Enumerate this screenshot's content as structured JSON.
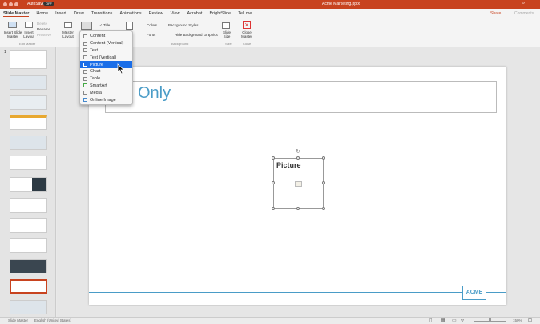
{
  "titlebar": {
    "autosave": "AutoSave",
    "autosave_state": "OFF",
    "filename": "Acme Marketing.pptx"
  },
  "tabs": [
    {
      "label": "Slide Master",
      "active": true
    },
    {
      "label": "Home"
    },
    {
      "label": "Insert"
    },
    {
      "label": "Draw"
    },
    {
      "label": "Transitions"
    },
    {
      "label": "Animations"
    },
    {
      "label": "Review"
    },
    {
      "label": "View"
    },
    {
      "label": "Acrobat"
    },
    {
      "label": "BrightSlide"
    },
    {
      "label": "Tell me"
    }
  ],
  "share": {
    "share": "Share",
    "comments": "Comments"
  },
  "ribbon": {
    "insert_slide_master": "Insert Slide Master",
    "insert_layout": "Insert Layout",
    "delete": "Delete",
    "rename": "Rename",
    "preserve": "Preserve",
    "edit_master": "Edit Master",
    "master_layout": "Master Layout",
    "title": "Title",
    "colors": "Colors",
    "background_styles": "Background Styles",
    "fonts": "Fonts",
    "hide_background_graphics": "Hide Background Graphics",
    "background": "Background",
    "slide_size": "Slide Size",
    "size": "Size",
    "close_master": "Close Master",
    "close": "Close"
  },
  "menu": {
    "items": [
      "Content",
      "Content (Vertical)",
      "Text",
      "Text (Vertical)",
      "Picture",
      "Chart",
      "Table",
      "SmartArt",
      "Media",
      "Online Image"
    ],
    "selected": "Picture"
  },
  "slide": {
    "title_text": "Only",
    "placeholder": "Picture",
    "logo": "ACME",
    "accent": "#4a9cc7"
  },
  "thumbs": {
    "first_number": "1"
  },
  "status": {
    "view": "Slide Master",
    "language": "English (United States)",
    "zoom": "150%"
  }
}
